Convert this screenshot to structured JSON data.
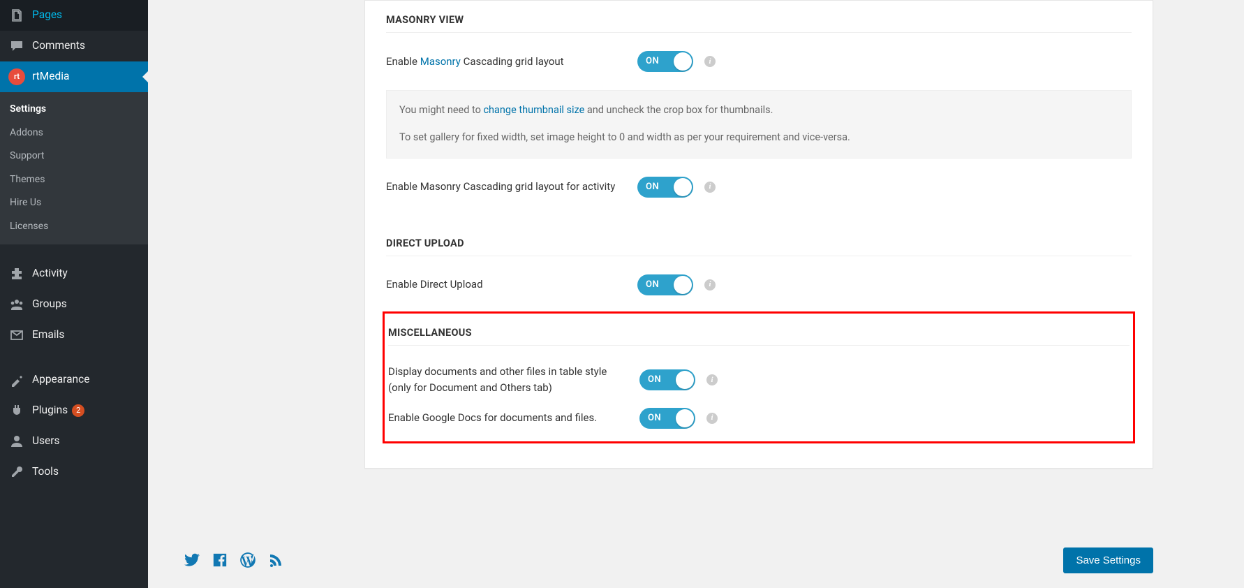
{
  "sidebar": {
    "items": [
      {
        "name": "pages",
        "label": "Pages",
        "icon": "pages"
      },
      {
        "name": "comments",
        "label": "Comments",
        "icon": "comment"
      },
      {
        "name": "rtmedia",
        "label": "rtMedia",
        "icon": "rtmedia",
        "active": true
      },
      {
        "name": "activity",
        "label": "Activity",
        "icon": "activity"
      },
      {
        "name": "groups",
        "label": "Groups",
        "icon": "groups"
      },
      {
        "name": "emails",
        "label": "Emails",
        "icon": "email"
      },
      {
        "name": "appearance",
        "label": "Appearance",
        "icon": "appearance"
      },
      {
        "name": "plugins",
        "label": "Plugins",
        "icon": "plugins",
        "badge": "2"
      },
      {
        "name": "users",
        "label": "Users",
        "icon": "users"
      },
      {
        "name": "tools",
        "label": "Tools",
        "icon": "tools"
      }
    ],
    "rtmedia_sub": [
      {
        "label": "Settings",
        "active": true
      },
      {
        "label": "Addons"
      },
      {
        "label": "Support"
      },
      {
        "label": "Themes"
      },
      {
        "label": "Hire Us"
      },
      {
        "label": "Licenses"
      }
    ]
  },
  "sections": {
    "masonry": {
      "heading": "Masonry View",
      "row1_prefix": "Enable ",
      "row1_link": "Masonry",
      "row1_suffix": " Cascading grid layout",
      "toggle1": "ON",
      "note_prefix": "You might need to ",
      "note_link": "change thumbnail size",
      "note_suffix": " and uncheck the crop box for thumbnails.",
      "note_line2": "To set gallery for fixed width, set image height to 0 and width as per your requirement and vice-versa.",
      "row2_label": "Enable Masonry Cascading grid layout for activity",
      "toggle2": "ON"
    },
    "direct_upload": {
      "heading": "Direct Upload",
      "row1_label": "Enable Direct Upload",
      "toggle1": "ON"
    },
    "misc": {
      "heading": "Miscellaneous",
      "row1_label": "Display documents and other files in table style (only for Document and Others tab)",
      "toggle1": "ON",
      "row2_label": "Enable Google Docs for documents and files.",
      "toggle2": "ON"
    }
  },
  "footer": {
    "save_label": "Save Settings"
  }
}
